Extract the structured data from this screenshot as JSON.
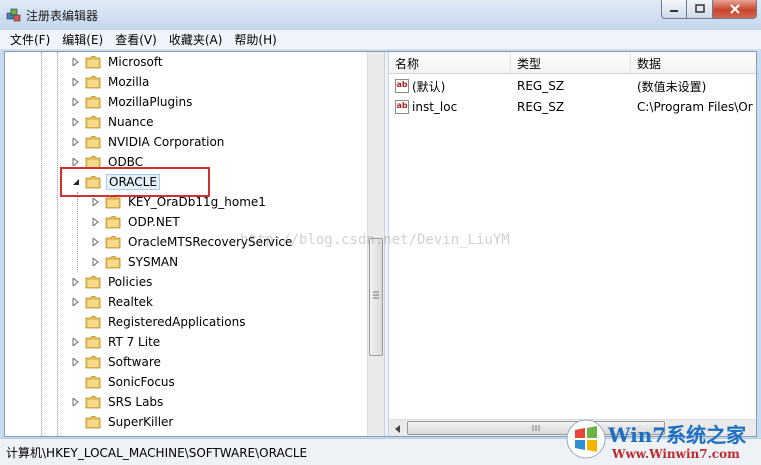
{
  "window": {
    "title": "注册表编辑器",
    "icons": {
      "app": "registry-editor-icon",
      "minimize": "minimize-icon",
      "maximize": "maximize-icon",
      "close": "close-icon"
    }
  },
  "menu": [
    "文件(F)",
    "编辑(E)",
    "查看(V)",
    "收藏夹(A)",
    "帮助(H)"
  ],
  "tree": [
    {
      "label": "Microsoft",
      "level": 0,
      "expander": "collapsed"
    },
    {
      "label": "Mozilla",
      "level": 0,
      "expander": "collapsed"
    },
    {
      "label": "MozillaPlugins",
      "level": 0,
      "expander": "collapsed"
    },
    {
      "label": "Nuance",
      "level": 0,
      "expander": "collapsed"
    },
    {
      "label": "NVIDIA Corporation",
      "level": 0,
      "expander": "collapsed"
    },
    {
      "label": "ODBC",
      "level": 0,
      "expander": "collapsed"
    },
    {
      "label": "ORACLE",
      "level": 0,
      "expander": "expanded",
      "selected": true
    },
    {
      "label": "KEY_OraDb11g_home1",
      "level": 1,
      "expander": "collapsed"
    },
    {
      "label": "ODP.NET",
      "level": 1,
      "expander": "collapsed"
    },
    {
      "label": "OracleMTSRecoveryService",
      "level": 1,
      "expander": "collapsed"
    },
    {
      "label": "SYSMAN",
      "level": 1,
      "expander": "collapsed"
    },
    {
      "label": "Policies",
      "level": 0,
      "expander": "collapsed"
    },
    {
      "label": "Realtek",
      "level": 0,
      "expander": "collapsed"
    },
    {
      "label": "RegisteredApplications",
      "level": 0,
      "expander": "none"
    },
    {
      "label": "RT 7 Lite",
      "level": 0,
      "expander": "collapsed"
    },
    {
      "label": "Software",
      "level": 0,
      "expander": "collapsed"
    },
    {
      "label": "SonicFocus",
      "level": 0,
      "expander": "none"
    },
    {
      "label": "SRS Labs",
      "level": 0,
      "expander": "collapsed"
    },
    {
      "label": "SuperKiller",
      "level": 0,
      "expander": "none"
    }
  ],
  "list": {
    "columns": [
      "名称",
      "类型",
      "数据"
    ],
    "rows": [
      {
        "name": "(默认)",
        "type": "REG_SZ",
        "data": "(数值未设置)"
      },
      {
        "name": "inst_loc",
        "type": "REG_SZ",
        "data": "C:\\Program Files\\Or"
      }
    ]
  },
  "status": "计算机\\HKEY_LOCAL_MACHINE\\SOFTWARE\\ORACLE",
  "watermark": "http://blog.csdn.net/Devin_LiuYM",
  "logo": {
    "main": "Win7系统之家",
    "sub": "Www.Winwin7.com"
  },
  "colors": {
    "highlight": "#d0312d",
    "folder": "#e8c15a",
    "selection": "#e5f0fb"
  }
}
